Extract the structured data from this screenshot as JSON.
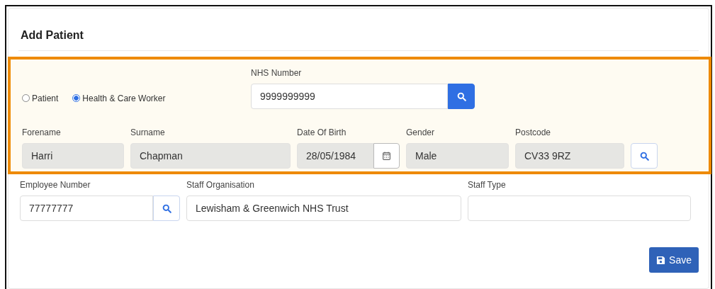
{
  "title": "Add Patient",
  "person_type": [
    {
      "label": "Patient",
      "selected": false
    },
    {
      "label": "Health & Care Worker",
      "selected": true
    }
  ],
  "nhs_number": {
    "label": "NHS Number",
    "value": "9999999999"
  },
  "fields": [
    {
      "kind": "text",
      "label": "Forename",
      "value": "Harri",
      "disabled": true
    },
    {
      "kind": "text",
      "label": "Surname",
      "value": "Chapman",
      "disabled": true
    },
    {
      "kind": "date",
      "label": "Date Of Birth",
      "value": "28/05/1984",
      "disabled": true
    },
    {
      "kind": "select",
      "label": "Gender",
      "value": "Male",
      "disabled": true
    },
    {
      "kind": "lookup",
      "label": "Postcode",
      "value": "CV33 9RZ",
      "disabled": true
    }
  ],
  "staff_fields": [
    {
      "kind": "lookup",
      "label": "Employee Number",
      "value": "77777777",
      "disabled": false
    },
    {
      "kind": "text",
      "label": "Staff Organisation",
      "value": "Lewisham & Greenwich NHS Trust",
      "disabled": false
    },
    {
      "kind": "text",
      "label": "Staff Type",
      "disabled": false
    }
  ],
  "save_button": "Save"
}
